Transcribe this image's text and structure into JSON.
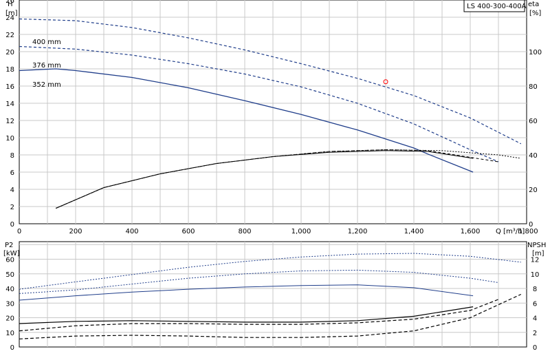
{
  "colors": {
    "blue": "#1f3d8a",
    "black": "#000000",
    "grid": "#c8c8c8",
    "marker": "#ff0000"
  },
  "chart_data": [
    {
      "type": "line",
      "model_label": "LS 400-300-400A",
      "left_axis": {
        "title": "H",
        "unit": "[m]",
        "ylim": [
          0,
          26
        ],
        "ticks": [
          "0",
          "2",
          "4",
          "6",
          "8",
          "10",
          "12",
          "14",
          "16",
          "18",
          "20",
          "22",
          "24",
          "26"
        ],
        "tick_values": [
          0,
          2,
          4,
          6,
          8,
          10,
          12,
          14,
          16,
          18,
          20,
          22,
          24,
          26
        ]
      },
      "right_axis": {
        "title": "eta",
        "unit": "[%]",
        "ylim": [
          0,
          130
        ],
        "ticks": [
          "0",
          "20",
          "40",
          "60",
          "80",
          "100"
        ],
        "tick_values": [
          0,
          20,
          40,
          60,
          80,
          100
        ]
      },
      "x_axis": {
        "label": "Q [m³/h]",
        "xlim": [
          0,
          1800
        ],
        "ticks": [
          "0",
          "200",
          "400",
          "600",
          "800",
          "1,000",
          "1,200",
          "1,400",
          "1,600",
          "1,800"
        ],
        "tick_values": [
          0,
          200,
          400,
          600,
          800,
          1000,
          1200,
          1400,
          1600,
          1800
        ]
      },
      "grid": true,
      "head_series": [
        {
          "name": "400 mm",
          "axis": "left",
          "x": [
            0,
            200,
            400,
            600,
            800,
            1000,
            1200,
            1400,
            1600,
            1780
          ],
          "y": [
            23.8,
            23.6,
            22.8,
            21.6,
            20.2,
            18.6,
            16.9,
            14.9,
            12.3,
            9.3
          ]
        },
        {
          "name": "376 mm",
          "axis": "left",
          "x": [
            0,
            200,
            400,
            600,
            800,
            1000,
            1200,
            1400,
            1600,
            1700
          ],
          "y": [
            20.6,
            20.3,
            19.6,
            18.6,
            17.4,
            15.9,
            14.0,
            11.6,
            8.6,
            7.2
          ]
        },
        {
          "name": "352 mm",
          "axis": "left",
          "x": [
            0,
            130,
            200,
            400,
            600,
            800,
            1000,
            1200,
            1400,
            1450,
            1610
          ],
          "y": [
            17.8,
            18.0,
            17.8,
            17.0,
            15.8,
            14.3,
            12.7,
            10.9,
            8.8,
            8.1,
            6.0
          ]
        }
      ],
      "efficiency_series": [
        {
          "axis": "right",
          "x": [
            130,
            300,
            500,
            700,
            900,
            1100,
            1300,
            1500,
            1700,
            1780
          ],
          "y": [
            9,
            21,
            29,
            35,
            39,
            42,
            43,
            42.5,
            40,
            38
          ]
        },
        {
          "axis": "right",
          "x": [
            130,
            300,
            500,
            700,
            900,
            1100,
            1300,
            1450,
            1700
          ],
          "y": [
            9,
            21,
            29,
            35,
            39,
            42,
            43,
            42.5,
            36
          ]
        },
        {
          "axis": "right",
          "x": [
            130,
            300,
            500,
            700,
            900,
            1100,
            1300,
            1450,
            1610
          ],
          "y": [
            9,
            21,
            29,
            35,
            39,
            41.5,
            42.5,
            42,
            38
          ]
        }
      ],
      "operating_point": {
        "x": 1300,
        "y": 16.5
      }
    },
    {
      "type": "line",
      "left_axis": {
        "title": "P2",
        "unit": "[kW]",
        "ylim": [
          0,
          72
        ],
        "ticks": [
          "0",
          "10",
          "20",
          "30",
          "40",
          "50",
          "60"
        ],
        "tick_values": [
          0,
          10,
          20,
          30,
          40,
          50,
          60
        ]
      },
      "right_axis": {
        "title": "NPSH",
        "unit": "[m]",
        "ylim": [
          0,
          14.4
        ],
        "ticks": [
          "0",
          "2",
          "4",
          "6",
          "8",
          "10",
          "12"
        ],
        "tick_values": [
          0,
          2,
          4,
          6,
          8,
          10,
          12
        ]
      },
      "x_axis": {
        "xlim": [
          0,
          1800
        ]
      },
      "grid": true,
      "power_series": [
        {
          "axis": "left",
          "x": [
            0,
            200,
            400,
            600,
            800,
            1000,
            1200,
            1400,
            1600,
            1780
          ],
          "y": [
            39.5,
            44.5,
            49.5,
            54.5,
            58.5,
            61.5,
            63.5,
            64,
            62,
            58
          ]
        },
        {
          "axis": "left",
          "x": [
            0,
            200,
            400,
            600,
            800,
            1000,
            1200,
            1400,
            1600,
            1700
          ],
          "y": [
            36.5,
            39,
            43,
            47,
            50,
            52,
            52.5,
            51,
            47,
            44
          ]
        },
        {
          "axis": "left",
          "x": [
            0,
            200,
            400,
            600,
            800,
            1000,
            1200,
            1400,
            1610
          ],
          "y": [
            32,
            35,
            37.5,
            39.5,
            41,
            42,
            42.5,
            40.5,
            35
          ]
        }
      ],
      "npsh_series": [
        {
          "axis": "right",
          "x": [
            0,
            200,
            400,
            600,
            800,
            1000,
            1200,
            1400,
            1600,
            1780
          ],
          "y": [
            1.1,
            1.5,
            1.6,
            1.5,
            1.3,
            1.3,
            1.5,
            2.2,
            4.0,
            7.2
          ]
        },
        {
          "axis": "right",
          "x": [
            0,
            200,
            400,
            600,
            800,
            1000,
            1200,
            1400,
            1600,
            1700
          ],
          "y": [
            2.2,
            2.9,
            3.2,
            3.2,
            3.1,
            3.1,
            3.3,
            3.8,
            5.0,
            6.5
          ]
        },
        {
          "axis": "right",
          "x": [
            0,
            200,
            400,
            600,
            800,
            1000,
            1200,
            1400,
            1610
          ],
          "y": [
            3.2,
            3.5,
            3.6,
            3.5,
            3.4,
            3.4,
            3.6,
            4.2,
            5.5
          ]
        }
      ]
    }
  ]
}
